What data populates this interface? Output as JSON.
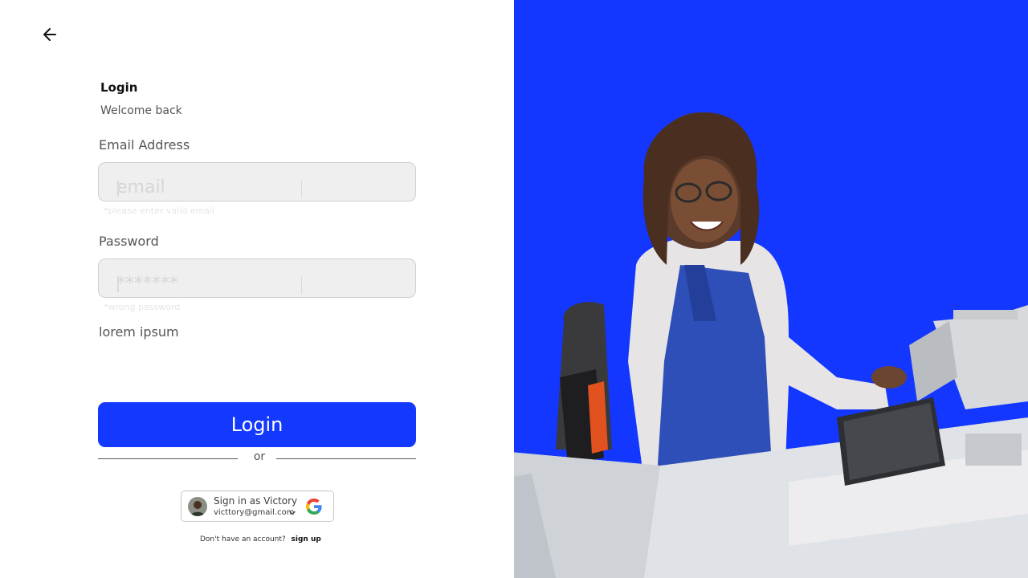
{
  "header": {
    "back_icon": "arrow-left-icon"
  },
  "form": {
    "title": "Login",
    "subtitle": "Welcome back",
    "email": {
      "label": "Email Address",
      "value": "",
      "placeholder": "email",
      "hint": "*please enter valid email"
    },
    "password": {
      "label": "Password",
      "value": "",
      "placeholder": "*******",
      "hint": "*wrong password"
    },
    "extra_label": "lorem ipsum",
    "submit_label": "Login",
    "divider_text": "or"
  },
  "google": {
    "name": "Sign in as Victory",
    "email": "victtory@gmail.com",
    "icon": "google-logo-icon"
  },
  "footer": {
    "prompt": "Don't have an account?",
    "link": "sign up"
  },
  "colors": {
    "primary": "#1339ff",
    "hero_bg": "#1337ff",
    "field_bg": "#efefef"
  }
}
